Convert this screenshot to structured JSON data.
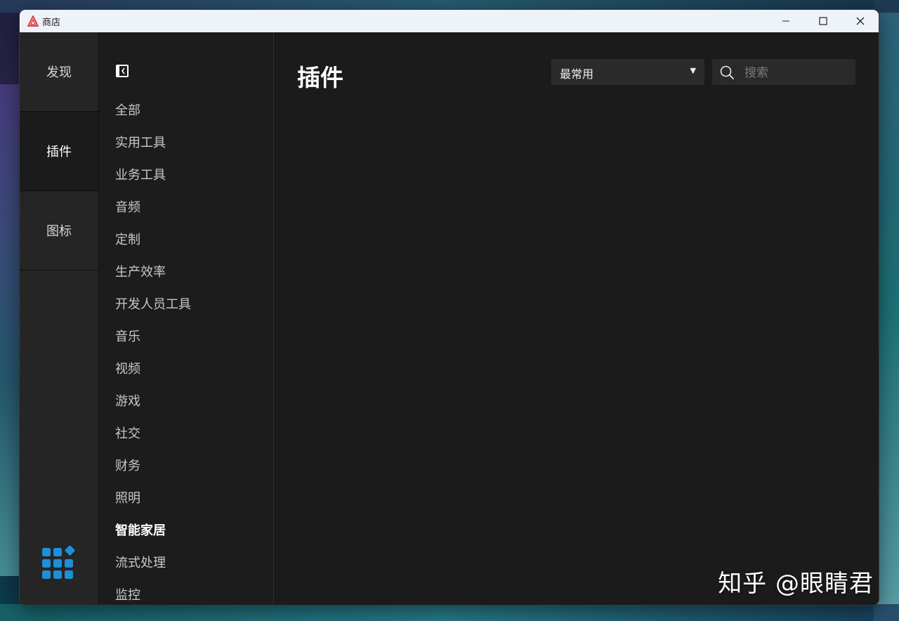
{
  "window": {
    "title": "商店",
    "controls": [
      "minimize-icon",
      "maximize-icon",
      "close-icon"
    ]
  },
  "rail": {
    "items": [
      {
        "label": "发现",
        "active": false
      },
      {
        "label": "插件",
        "active": true
      },
      {
        "label": "图标",
        "active": false
      }
    ],
    "footer_icon": "apps-grid-icon"
  },
  "categories": {
    "toggle_icon": "sidebar-collapse-icon",
    "items": [
      {
        "label": "全部"
      },
      {
        "label": "实用工具"
      },
      {
        "label": "业务工具"
      },
      {
        "label": "音频"
      },
      {
        "label": "定制"
      },
      {
        "label": "生产效率"
      },
      {
        "label": "开发人员工具"
      },
      {
        "label": "音乐"
      },
      {
        "label": "视频"
      },
      {
        "label": "游戏"
      },
      {
        "label": "社交"
      },
      {
        "label": "财务"
      },
      {
        "label": "照明"
      },
      {
        "label": "智能家居",
        "active": true
      },
      {
        "label": "流式处理"
      },
      {
        "label": "监控"
      }
    ]
  },
  "main": {
    "title": "插件",
    "sort": {
      "selected": "最常用"
    },
    "search": {
      "placeholder": "搜索",
      "value": ""
    }
  },
  "watermark": "知乎 @眼睛君",
  "colors": {
    "window_bg": "#1b1b1b",
    "rail_bg": "#252525",
    "titlebar_bg": "#eef3f9",
    "accent_blue": "#1e8fd8",
    "app_icon_red": "#d9363e"
  }
}
